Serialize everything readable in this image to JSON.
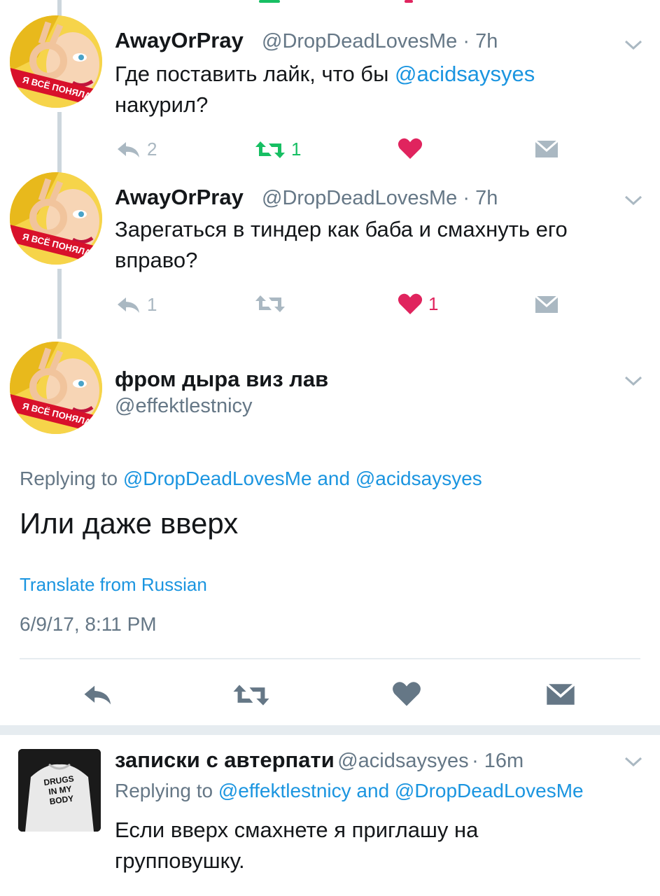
{
  "tweets": [
    {
      "name": "AwayOrPray",
      "handle": "@DropDeadLovesMe",
      "time": "· 7h",
      "text_before": "Где поставить лайк, что бы ",
      "mention": "@acidsaysyes",
      "text_after": " накурил?",
      "reply_count": "2",
      "retweet_count": "1",
      "like_count": ""
    },
    {
      "name": "AwayOrPray",
      "handle": "@DropDeadLovesMe",
      "time": "· 7h",
      "text": "Зарегаться в тиндер как баба и смахнуть его вправо?",
      "reply_count": "1",
      "retweet_count": "",
      "like_count": "1"
    }
  ],
  "avatar_badge": "Я ВСЁ ПОНЯЛА",
  "focused": {
    "name": "фром дыра виз лав",
    "handle": "@effektlestnicy",
    "replying_prefix": "Replying to ",
    "replying_user1": "@DropDeadLovesMe",
    "replying_and": " and ",
    "replying_user2": "@acidsaysyes",
    "text": "Или даже вверх",
    "translate": "Translate from Russian",
    "timestamp": "6/9/17, 8:11 PM"
  },
  "reply": {
    "name": "записки с автерпати",
    "handle": "@acidsaysyes",
    "time": "· 16m",
    "replying_prefix": "Replying to ",
    "replying_user1": "@effektlestnicy",
    "replying_and": " and ",
    "replying_user2": "@DropDeadLovesMe",
    "text": "Если вверх смахнете я приглашу на групповушку.",
    "avatar_text": "DRUGS IN MY BODY"
  },
  "colors": {
    "accent": "#1b95e0",
    "retweet": "#17bf63",
    "like": "#e0245e",
    "icon_gray": "#aab8c2",
    "secondary_text": "#657786"
  },
  "icons": [
    "reply-icon",
    "retweet-icon",
    "like-icon",
    "direct-message-icon",
    "chevron-down-icon"
  ]
}
